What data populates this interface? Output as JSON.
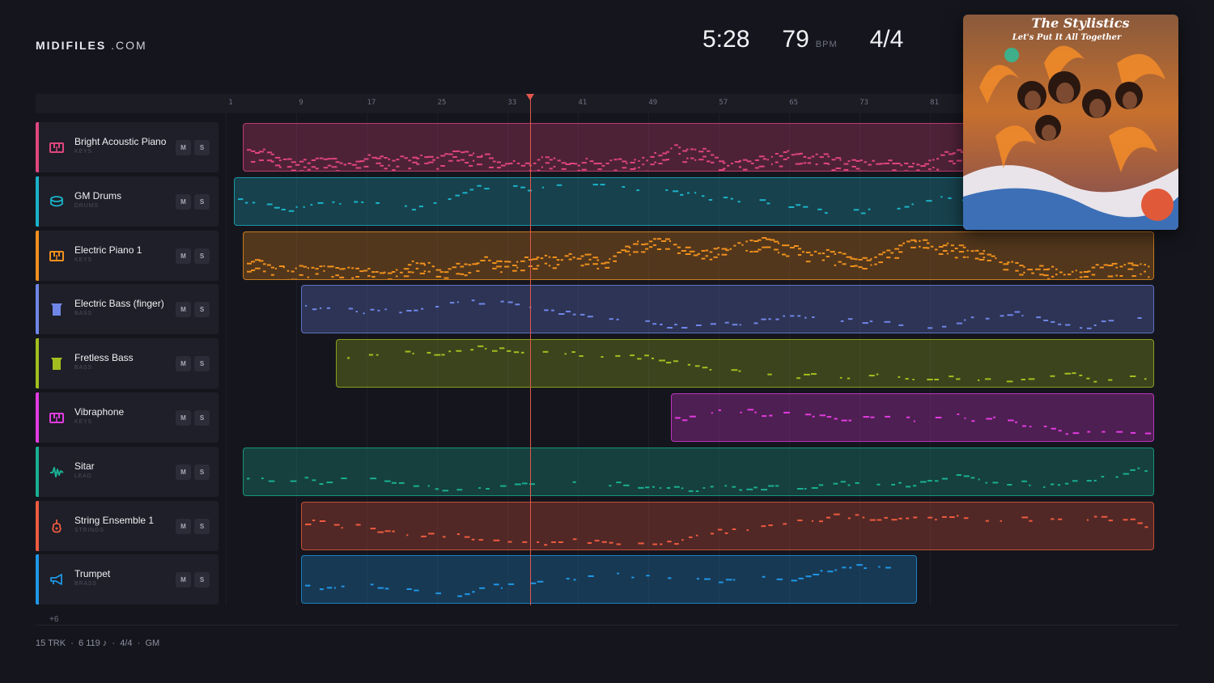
{
  "logo": {
    "brand": "MIDIFILES",
    "suffix": ".COM"
  },
  "stats": {
    "duration": "5:28",
    "bpm": "79",
    "bpm_unit": "BPM",
    "time_signature": "4/4"
  },
  "ruler": {
    "ticks": [
      "1",
      "9",
      "17",
      "25",
      "33",
      "41",
      "49",
      "57",
      "65",
      "73",
      "81"
    ]
  },
  "playhead": {
    "bar": 33
  },
  "tracks": [
    {
      "name": "Bright Acoustic Piano",
      "category": "KEYS",
      "color": "#e0457c",
      "icon": "piano-icon",
      "mute": "M",
      "solo": "S",
      "region": {
        "start": 1.1,
        "end": 1000000000.0
      }
    },
    {
      "name": "GM Drums",
      "category": "DRUMS",
      "color": "#1bb3c9",
      "icon": "drum-icon",
      "mute": "M",
      "solo": "S",
      "region": {
        "start": 1,
        "end": 1000000000.0
      }
    },
    {
      "name": "Electric Piano 1",
      "category": "KEYS",
      "color": "#f0901e",
      "icon": "piano-icon",
      "mute": "M",
      "solo": "S",
      "region": {
        "start": 1.1,
        "end": 106
      }
    },
    {
      "name": "Electric Bass (finger)",
      "category": "BASS",
      "color": "#6f86e8",
      "icon": "bass-icon",
      "mute": "M",
      "solo": "S",
      "region": {
        "start": 9,
        "end": 106
      }
    },
    {
      "name": "Fretless Bass",
      "category": "BASS",
      "color": "#a2bf1f",
      "icon": "bass-icon",
      "mute": "M",
      "solo": "S",
      "region": {
        "start": 13,
        "end": 106
      }
    },
    {
      "name": "Vibraphone",
      "category": "KEYS",
      "color": "#e23be0",
      "icon": "piano-icon",
      "mute": "M",
      "solo": "S",
      "region": {
        "start": 51,
        "end": 106
      }
    },
    {
      "name": "Sitar",
      "category": "LEAD",
      "color": "#1aaf92",
      "icon": "wave-icon",
      "mute": "M",
      "solo": "S",
      "region": {
        "start": 1.1,
        "end": 106
      }
    },
    {
      "name": "String Ensemble 1",
      "category": "STRINGS",
      "color": "#ee5a3f",
      "icon": "violin-icon",
      "mute": "M",
      "solo": "S",
      "region": {
        "start": 9,
        "end": 106
      }
    },
    {
      "name": "Trumpet",
      "category": "BRASS",
      "color": "#1f97e6",
      "icon": "trumpet-icon",
      "mute": "M",
      "solo": "S",
      "region": {
        "start": 9,
        "end": 79
      }
    }
  ],
  "more_tracks": "+6",
  "footer": {
    "tracks": "15 TRK",
    "notes": "6 119 ♪",
    "time_signature": "4/4",
    "standard": "GM",
    "separator": "·"
  },
  "cover": {
    "artist": "The Stylistics",
    "album": "Let's Put It All Together"
  }
}
